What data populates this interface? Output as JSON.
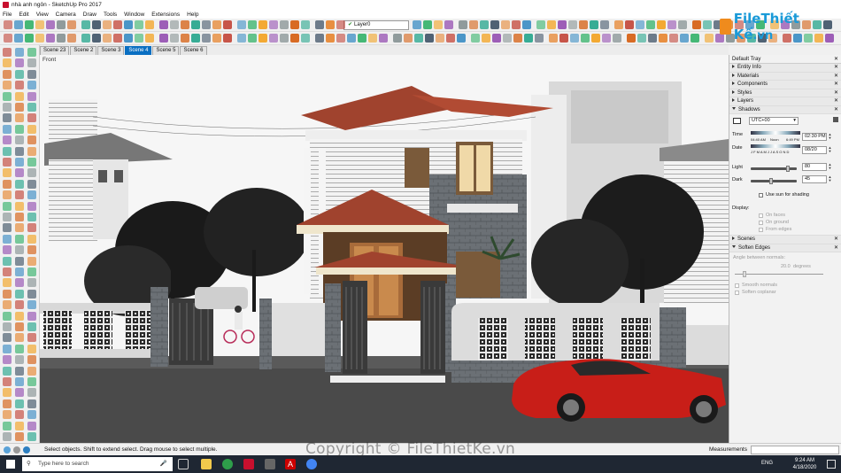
{
  "window": {
    "title": "nhà anh ngôn - SketchUp Pro 2017"
  },
  "menu": [
    "File",
    "Edit",
    "View",
    "Camera",
    "Draw",
    "Tools",
    "Window",
    "Extensions",
    "Help"
  ],
  "layer_select": {
    "value": "Layer0"
  },
  "scenes": [
    "Scene 23",
    "Scene 2",
    "Scene 3",
    "Scene 4",
    "Scene 5",
    "Scene 6"
  ],
  "active_scene": "Scene 4",
  "viewport": {
    "view_label": "Front"
  },
  "tray": {
    "title": "Default Tray",
    "collapsed_sections": [
      "Entity Info",
      "Materials",
      "Components",
      "Styles",
      "Layers"
    ],
    "shadows": {
      "title": "Shadows",
      "utc": "UTC+00",
      "time_label": "Time",
      "time_start": "04:40 AM",
      "time_noon": "Noon",
      "time_end": "6:49 PM",
      "time_value": "02:30 PM",
      "date_label": "Date",
      "months": "J F M A M J J A S O N D",
      "date_value": "08/20",
      "light_label": "Light",
      "light_value": "80",
      "dark_label": "Dark",
      "dark_value": "45",
      "use_sun": "Use sun for shading",
      "display_label": "Display:",
      "on_faces": "On faces",
      "on_ground": "On ground",
      "from_edges": "From edges"
    },
    "scenes_section": "Scenes",
    "soften": {
      "title": "Soften Edges",
      "angle_label": "Angle between normals:",
      "angle_value": "20.0",
      "angle_unit": "degrees",
      "smooth": "Smooth normals",
      "coplanar": "Soften coplanar"
    }
  },
  "status": {
    "message": "Select objects. Shift to extend select. Drag mouse to select multiple.",
    "measurements_label": "Measurements"
  },
  "taskbar": {
    "search_placeholder": "Type here to search",
    "time": "9:24 AM",
    "date": "4/18/2020",
    "lang": "ENG"
  },
  "watermark": "Copyright © FileThietKe.vn",
  "logo": {
    "text": "FileThiết Kế",
    "suffix": ".vn"
  },
  "colors": {
    "active_tab": "#0a6fc2",
    "roof": "#a0432e",
    "car": "#c81e18",
    "taskbar": "#1f2733",
    "logo_blue": "#1a9ad8",
    "logo_orange": "#ef8b1d"
  }
}
